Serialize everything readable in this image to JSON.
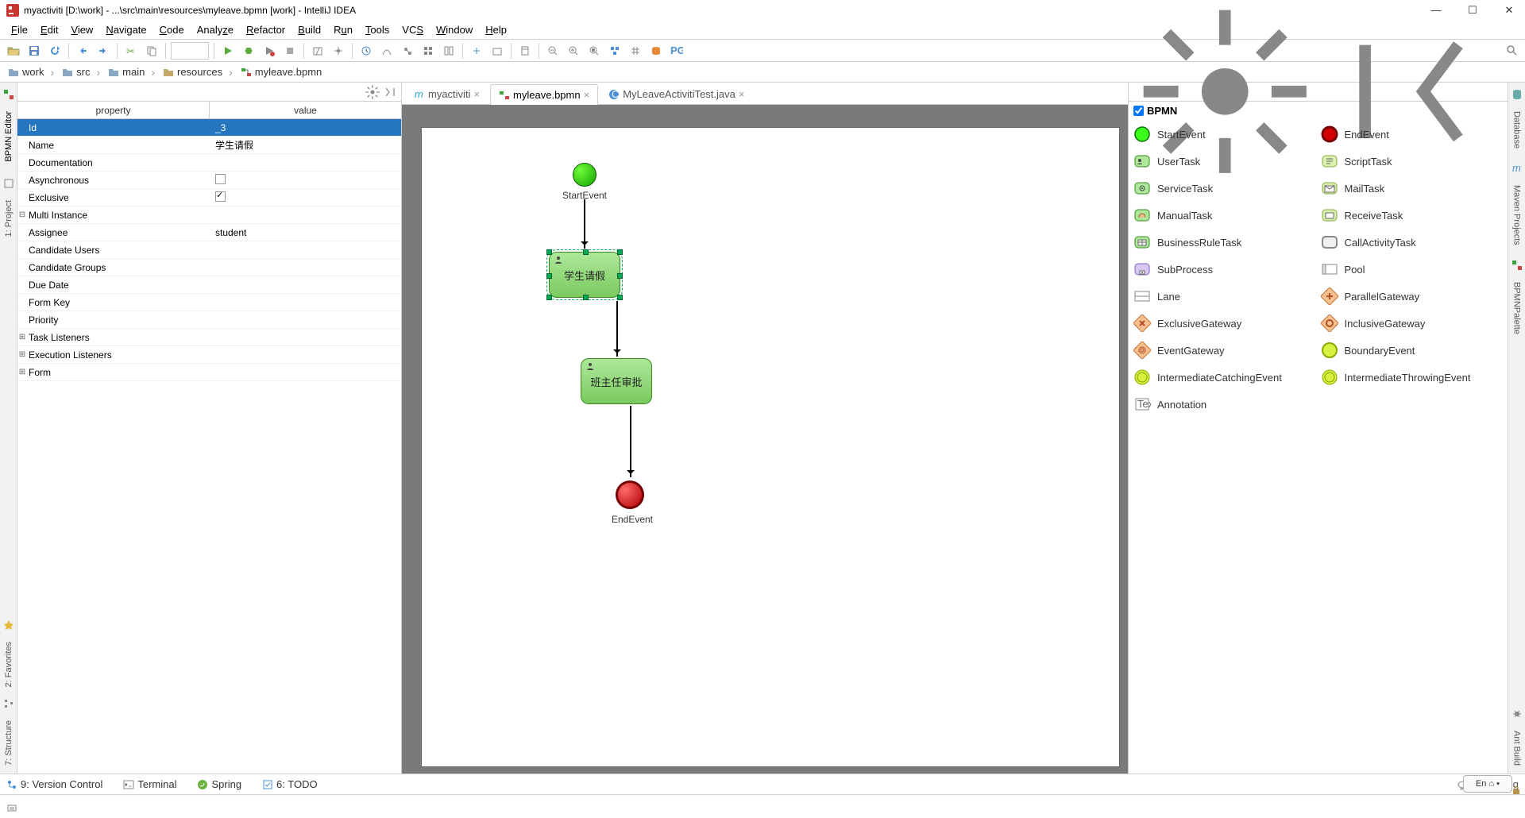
{
  "title": "myactiviti [D:\\work] - ...\\src\\main\\resources\\myleave.bpmn [work] - IntelliJ IDEA",
  "menu": [
    "File",
    "Edit",
    "View",
    "Navigate",
    "Code",
    "Analyze",
    "Refactor",
    "Build",
    "Run",
    "Tools",
    "VCS",
    "Window",
    "Help"
  ],
  "breadcrumbs": [
    "work",
    "src",
    "main",
    "resources",
    "myleave.bpmn"
  ],
  "leftGutter": {
    "top": "BPMN Editor",
    "mid": "1: Project",
    "fav": "2: Favorites",
    "str": "7: Structure"
  },
  "rightGutter": {
    "db": "Database",
    "mvn": "Maven Projects",
    "pal": "BPMNPalette",
    "ant": "Ant Build"
  },
  "propsHeader": {
    "p": "property",
    "v": "value"
  },
  "props": [
    {
      "k": "Id",
      "v": "_3",
      "sel": true
    },
    {
      "k": "Name",
      "v": "学生请假"
    },
    {
      "k": "Documentation",
      "v": ""
    },
    {
      "k": "Asynchronous",
      "v": "",
      "chk": false,
      "isChk": true
    },
    {
      "k": "Exclusive",
      "v": "",
      "chk": true,
      "isChk": true
    },
    {
      "k": "Multi Instance",
      "v": "",
      "exp": "-"
    },
    {
      "k": "Assignee",
      "v": "student"
    },
    {
      "k": "Candidate Users",
      "v": ""
    },
    {
      "k": "Candidate Groups",
      "v": ""
    },
    {
      "k": "Due Date",
      "v": ""
    },
    {
      "k": "Form Key",
      "v": ""
    },
    {
      "k": "Priority",
      "v": ""
    },
    {
      "k": "Task Listeners",
      "v": "",
      "exp": "+"
    },
    {
      "k": "Execution Listeners",
      "v": "",
      "exp": "+"
    },
    {
      "k": "Form",
      "v": "",
      "exp": "+"
    }
  ],
  "tabs": [
    {
      "label": "myactiviti",
      "active": false,
      "color": "#2aa7d8"
    },
    {
      "label": "myleave.bpmn",
      "active": true,
      "color": "#3aa63a"
    },
    {
      "label": "MyLeaveActivitiTest.java",
      "active": false,
      "color": "#2aa7d8"
    }
  ],
  "diagram": {
    "start": "StartEvent",
    "task1": "学生请假",
    "task2": "班主任审批",
    "end": "EndEvent"
  },
  "palette": {
    "title": "BPMN",
    "items": [
      [
        "StartEvent",
        "start"
      ],
      [
        "EndEvent",
        "end"
      ],
      [
        "UserTask",
        "user"
      ],
      [
        "ScriptTask",
        "script"
      ],
      [
        "ServiceTask",
        "service"
      ],
      [
        "MailTask",
        "mail"
      ],
      [
        "ManualTask",
        "manual"
      ],
      [
        "ReceiveTask",
        "receive"
      ],
      [
        "BusinessRuleTask",
        "rule"
      ],
      [
        "CallActivityTask",
        "call"
      ],
      [
        "SubProcess",
        "sub"
      ],
      [
        "Pool",
        "pool"
      ],
      [
        "Lane",
        "lane"
      ],
      [
        "ParallelGateway",
        "pgw"
      ],
      [
        "ExclusiveGateway",
        "xgw"
      ],
      [
        "InclusiveGateway",
        "igw"
      ],
      [
        "EventGateway",
        "egw"
      ],
      [
        "BoundaryEvent",
        "bev"
      ],
      [
        "IntermediateCatchingEvent",
        "ice"
      ],
      [
        "IntermediateThrowingEvent",
        "ite"
      ],
      [
        "Annotation",
        "anno"
      ]
    ]
  },
  "bottom": {
    "vc": "9: Version Control",
    "term": "Terminal",
    "spring": "Spring",
    "todo": "6: TODO",
    "elog": "Event Log"
  },
  "ime": "En ⌂ •"
}
